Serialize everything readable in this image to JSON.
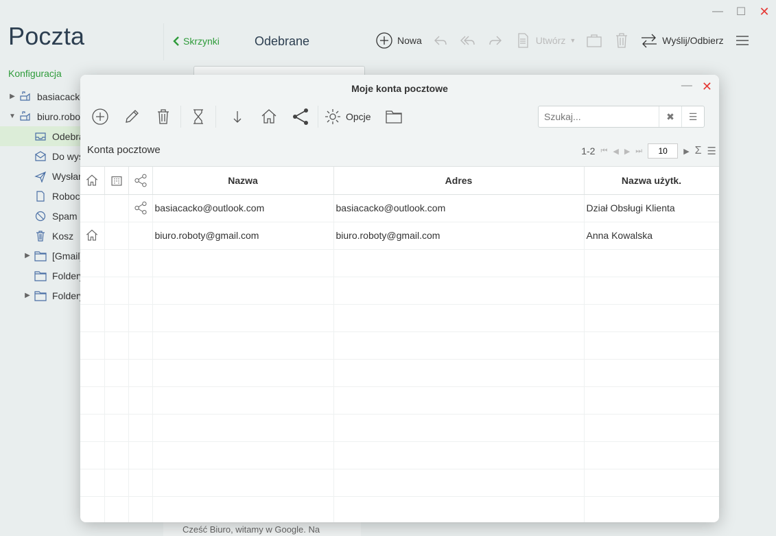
{
  "app": {
    "title": "Poczta",
    "config_link": "Konfiguracja"
  },
  "window": {
    "minimize": "—",
    "maximize": "☐",
    "close": "✕"
  },
  "sidebar": {
    "items": [
      {
        "label": "basiacacko@outlook.com",
        "level": 0,
        "arrow": "▶",
        "icon": "mailbox-icon"
      },
      {
        "label": "biuro.roboty@gmail.com",
        "level": 0,
        "arrow": "▼",
        "icon": "mailbox-icon"
      },
      {
        "label": "Odebrane",
        "level": 1,
        "icon": "inbox-icon",
        "selected": true
      },
      {
        "label": "Do wysłania",
        "level": 1,
        "icon": "outbox-icon"
      },
      {
        "label": "Wysłane",
        "level": 1,
        "icon": "sent-icon"
      },
      {
        "label": "Robocze",
        "level": 1,
        "icon": "draft-icon"
      },
      {
        "label": "Spam",
        "level": 1,
        "icon": "spam-icon"
      },
      {
        "label": "Kosz",
        "level": 1,
        "icon": "trash-icon"
      },
      {
        "label": "[Gmail]",
        "level": 1,
        "arrow": "▶",
        "icon": "folder-icon"
      },
      {
        "label": "Foldery",
        "level": 1,
        "icon": "folder-icon"
      },
      {
        "label": "Foldery",
        "level": 1,
        "arrow": "▶",
        "icon": "folder-icon"
      }
    ]
  },
  "topbar": {
    "back": "Skrzynki",
    "title": "Odebrane",
    "new": "Nowa",
    "create": "Utwórz",
    "send_receive": "Wyślij/Odbierz"
  },
  "background": {
    "search_placeholder": "Szukaj...",
    "footer_text": "Cześć Biuro, witamy w Google. Na"
  },
  "dialog": {
    "title": "Moje konta pocztowe",
    "minimize": "—",
    "close": "✕",
    "options_label": "Opcje",
    "search_placeholder": "Szukaj...",
    "section_title": "Konta pocztowe",
    "pager": {
      "range": "1-2",
      "page_size": "10"
    },
    "table": {
      "columns": [
        "Nazwa",
        "Adres",
        "Nazwa użytk."
      ],
      "rows": [
        {
          "default": false,
          "shared": true,
          "name": "basiacacko@outlook.com",
          "address": "basiacacko@outlook.com",
          "user": "Dział Obsługi Klienta"
        },
        {
          "default": true,
          "shared": false,
          "name": "biuro.roboty@gmail.com",
          "address": "biuro.roboty@gmail.com",
          "user": "Anna Kowalska"
        }
      ],
      "empty_rows": 10
    }
  }
}
